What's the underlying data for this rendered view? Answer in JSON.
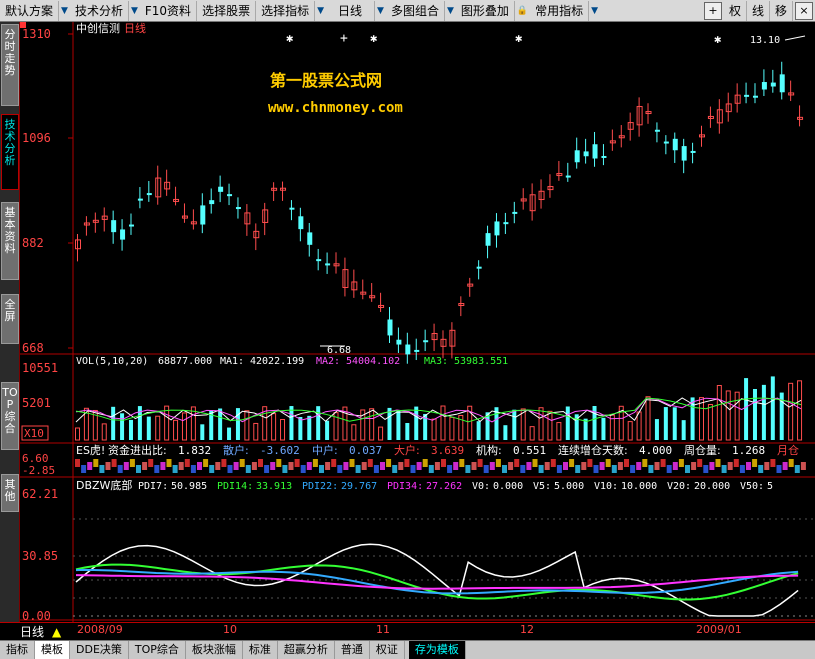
{
  "toolbar": {
    "items": [
      "默认方案",
      "技术分析",
      "F10资料",
      "选择股票",
      "选择指标",
      "日线",
      "多图组合",
      "图形叠加",
      "常用指标"
    ],
    "right_buttons": [
      "权",
      "线",
      "移"
    ],
    "plus_icon": "+",
    "close_icon": "×"
  },
  "sidebar": {
    "tabs": [
      "分时走势",
      "技术分析",
      "基本资料",
      "全屏",
      "TOP综合",
      "其他"
    ],
    "active_index": 1
  },
  "main_chart": {
    "stock_name": "中创信测",
    "period": "日线",
    "y_labels": [
      "1310",
      "1096",
      "882",
      "668"
    ],
    "high_label": "13.10",
    "low_label": "6.68",
    "watermark_title": "第一股票公式网",
    "watermark_url": "www.chnmoney.com"
  },
  "vol_panel": {
    "name": "VOL(5,10,20)",
    "value": "68877.000",
    "ma1_label": "MA1:",
    "ma1": "42022.199",
    "ma2_label": "MA2:",
    "ma2": "54004.102",
    "ma3_label": "MA3:",
    "ma3": "53983.551",
    "y_labels": [
      "10551",
      "5201"
    ],
    "multiplier": "X10"
  },
  "es_panel": {
    "title": "ES虎!",
    "items": [
      {
        "label": "资金进出比:",
        "value": "1.832",
        "color": "#ffffff"
      },
      {
        "label": "散户:",
        "value": "-3.602",
        "color": "#6fa8ff"
      },
      {
        "label": "中户:",
        "value": "0.037",
        "color": "#6fa8ff"
      },
      {
        "label": "大户:",
        "value": "3.639",
        "color": "#ff4444"
      },
      {
        "label": "机构:",
        "value": "0.551",
        "color": "#ffffff"
      },
      {
        "label": "连续增仓天数:",
        "value": "4.000",
        "color": "#ffffff"
      },
      {
        "label": "周仓量:",
        "value": "1.268",
        "color": "#ffffff"
      },
      {
        "label": "月仓",
        "value": "",
        "color": "#ff4444"
      }
    ],
    "y_labels": [
      "6.60",
      "-2.85"
    ]
  },
  "dbzw_panel": {
    "name": "DBZW底部",
    "items": [
      {
        "label": "PDI7:",
        "value": "50.985",
        "color": "#ffffff"
      },
      {
        "label": "PDI14:",
        "value": "33.913",
        "color": "#33ff33"
      },
      {
        "label": "PDI22:",
        "value": "29.767",
        "color": "#33aaff"
      },
      {
        "label": "PDI34:",
        "value": "27.262",
        "color": "#ff33ff"
      },
      {
        "label": "V0:",
        "value": "0.000",
        "color": "#ffffff"
      },
      {
        "label": "V5:",
        "value": "5.000",
        "color": "#ffffff"
      },
      {
        "label": "V10:",
        "value": "10.000",
        "color": "#ffffff"
      },
      {
        "label": "V20:",
        "value": "20.000",
        "color": "#ffffff"
      },
      {
        "label": "V50:",
        "value": "5",
        "color": "#ffffff"
      }
    ],
    "y_labels": [
      "62.21",
      "30.85",
      "0.00"
    ]
  },
  "date_axis": {
    "period": "日线",
    "labels": [
      "2008/09",
      "10",
      "11",
      "12",
      "2009/01"
    ]
  },
  "bottom_tabs": {
    "items": [
      "指标",
      "模板",
      "DDE决策",
      "TOP综合",
      "板块涨幅",
      "标准",
      "超赢分析",
      "普通",
      "权证",
      "存为模板"
    ],
    "active_index": 9,
    "selected_index": 1
  },
  "colors": {
    "up": "#ff4d4d",
    "down": "#55ffff",
    "axis": "#b00000"
  }
}
